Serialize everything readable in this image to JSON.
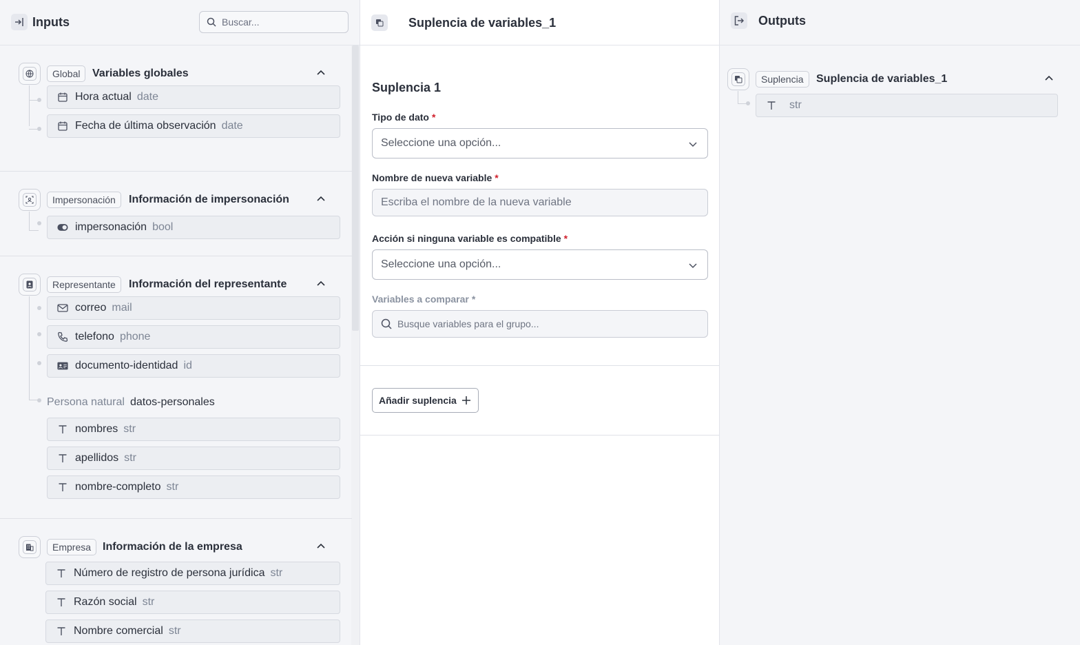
{
  "inputs": {
    "title": "Inputs",
    "search_placeholder": "Buscar...",
    "groups": [
      {
        "tag": "Global",
        "title": "Variables globales",
        "items": [
          {
            "name": "Hora actual",
            "type": "date",
            "icon": "calendar-icon"
          },
          {
            "name": "Fecha de última observación",
            "type": "date",
            "icon": "calendar-icon"
          }
        ]
      },
      {
        "tag": "Impersonación",
        "title": "Información de impersonación",
        "items": [
          {
            "name": "impersonación",
            "type": "bool",
            "icon": "toggle-icon"
          }
        ]
      },
      {
        "tag": "Representante",
        "title": "Información del representante",
        "items": [
          {
            "name": "correo",
            "type": "mail",
            "icon": "mail-icon"
          },
          {
            "name": "telefono",
            "type": "phone",
            "icon": "phone-icon"
          },
          {
            "name": "documento-identidad",
            "type": "id",
            "icon": "id-card-icon"
          }
        ],
        "subgroup": {
          "label": "Persona natural",
          "name": "datos-personales",
          "items": [
            {
              "name": "nombres",
              "type": "str",
              "icon": "text-icon"
            },
            {
              "name": "apellidos",
              "type": "str",
              "icon": "text-icon"
            },
            {
              "name": "nombre-completo",
              "type": "str",
              "icon": "text-icon"
            }
          ]
        }
      },
      {
        "tag": "Empresa",
        "title": "Información de la empresa",
        "items": [
          {
            "name": "Número de registro de persona jurídica",
            "type": "str",
            "icon": "text-icon"
          },
          {
            "name": "Razón social",
            "type": "str",
            "icon": "text-icon"
          },
          {
            "name": "Nombre comercial",
            "type": "str",
            "icon": "text-icon"
          }
        ]
      }
    ]
  },
  "editor": {
    "title": "Suplencia de variables_1",
    "section_title": "Suplencia 1",
    "fields": {
      "data_type": {
        "label": "Tipo de dato",
        "required": "*",
        "value": "Seleccione una opción..."
      },
      "new_var_name": {
        "label": "Nombre de nueva variable",
        "required": "*",
        "placeholder": "Escriba el nombre de la nueva variable"
      },
      "no_match_action": {
        "label": "Acción si ninguna variable es compatible",
        "required": "*",
        "value": "Seleccione una opción..."
      },
      "compare_vars": {
        "label": "Variables a comparar",
        "required": "*",
        "placeholder": "Busque variables para el grupo..."
      }
    },
    "add_button": "Añadir suplencia"
  },
  "outputs": {
    "title": "Outputs",
    "group": {
      "tag": "Suplencia",
      "title": "Suplencia de variables_1",
      "items": [
        {
          "name": "",
          "type": "str",
          "icon": "text-icon"
        }
      ]
    }
  },
  "colors": {
    "panel_bg": "#f4f5f8",
    "border": "#e2e4ea",
    "required": "#d0202c",
    "muted_text": "#7d8594"
  }
}
